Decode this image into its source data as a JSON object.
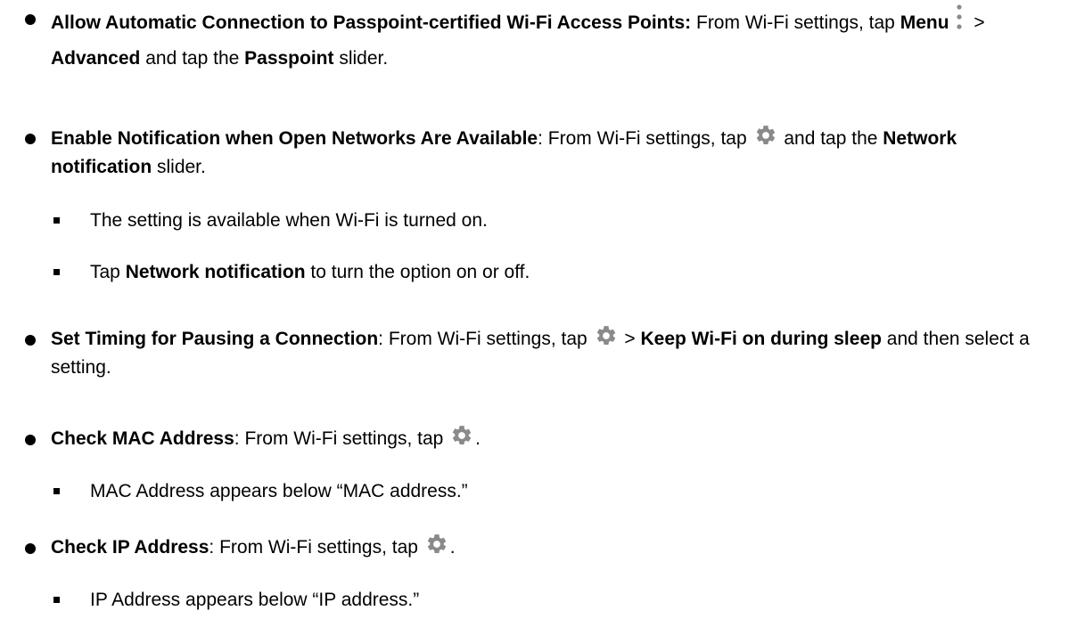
{
  "items": [
    {
      "title": "Allow Automatic Connection to Passpoint-certified Wi-Fi Access Points:",
      "text1": " From Wi-Fi settings, tap ",
      "menu": "Menu",
      "sep": " > ",
      "advanced": "Advanced",
      "text2": " and tap the ",
      "passpoint": "Passpoint",
      "text3": " slider."
    },
    {
      "title": "Enable Notification when Open Networks Are Available",
      "text1": ": From Wi-Fi settings, tap ",
      "text2": " and tap the ",
      "network_notification": "Network notification",
      "text3": " slider.",
      "subs": [
        {
          "text": "The setting is available when Wi-Fi is turned on."
        },
        {
          "pre": "Tap ",
          "bold": "Network notification",
          "post": " to turn the option on or off."
        }
      ]
    },
    {
      "title": "Set Timing for Pausing a Connection",
      "text1": ": From Wi-Fi settings, tap ",
      "sep": " > ",
      "keep": "Keep Wi-Fi on during sleep",
      "text2": " and then select a setting."
    },
    {
      "title": "Check MAC Address",
      "text1": ": From Wi-Fi settings, tap ",
      "end": ".",
      "subs": [
        {
          "text": "MAC Address appears below “MAC address.”"
        }
      ]
    },
    {
      "title": "Check IP Address",
      "text1": ": From Wi-Fi settings, tap ",
      "end": ".",
      "subs": [
        {
          "text": "IP Address appears below “IP address.”"
        }
      ]
    }
  ],
  "icons": {
    "gear": "gear-icon",
    "menu": "vertical-dots-menu-icon",
    "gear_color": "#8a8a8a",
    "menu_color": "#8a8a8a"
  }
}
